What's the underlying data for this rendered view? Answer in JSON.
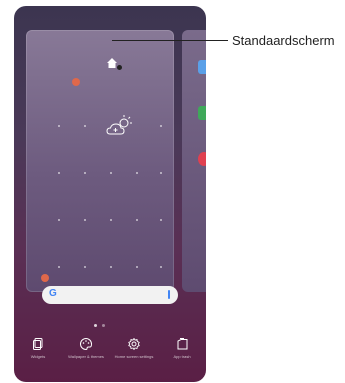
{
  "callout": {
    "label": "Standaardscherm"
  },
  "bottom_actions": [
    {
      "label": "Widgets",
      "icon": "widgets-icon"
    },
    {
      "label": "Wallpaper & themes",
      "icon": "palette-icon"
    },
    {
      "label": "Home screen settings",
      "icon": "gear-icon"
    },
    {
      "label": "App trash",
      "icon": "trash-icon"
    }
  ],
  "search_bar": {
    "logo": "G"
  },
  "side_apps": [
    {
      "icon": "calendar-app-icon",
      "color": "#5aa0e8"
    },
    {
      "icon": "maps-app-icon",
      "color": "#3fa85a"
    },
    {
      "icon": "app-icon",
      "color": "#e04050"
    }
  ]
}
